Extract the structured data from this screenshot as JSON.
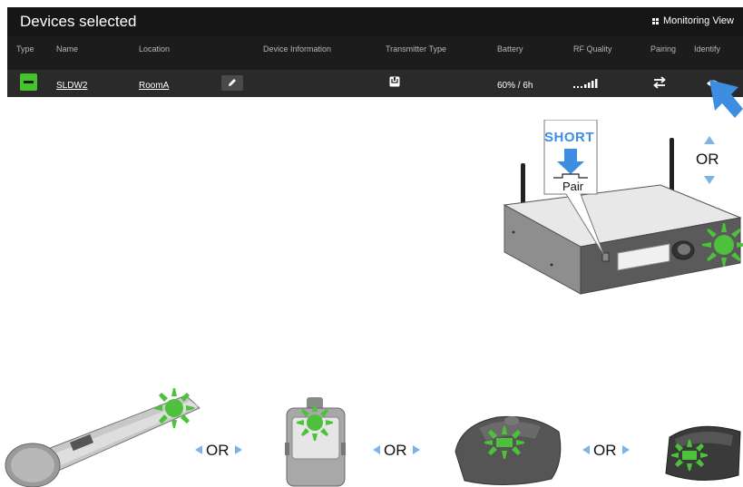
{
  "header": {
    "title": "Devices selected",
    "monitoring_label": "Monitoring View"
  },
  "columns": {
    "type": "Type",
    "name": "Name",
    "location": "Location",
    "device_info": "Device Information",
    "transmitter_type": "Transmitter Type",
    "battery": "Battery",
    "rf_quality": "RF Quality",
    "pairing": "Pairing",
    "identify": "Identify"
  },
  "device": {
    "name": "SLDW2",
    "location": "RoomA",
    "battery": "60% / 6h",
    "status_color": "#45c32a"
  },
  "illustration": {
    "short_label": "SHORT",
    "pair_label": "Pair",
    "or_label": "OR",
    "accent_blue": "#3d8ee0",
    "led_green": "#4ec13c"
  }
}
